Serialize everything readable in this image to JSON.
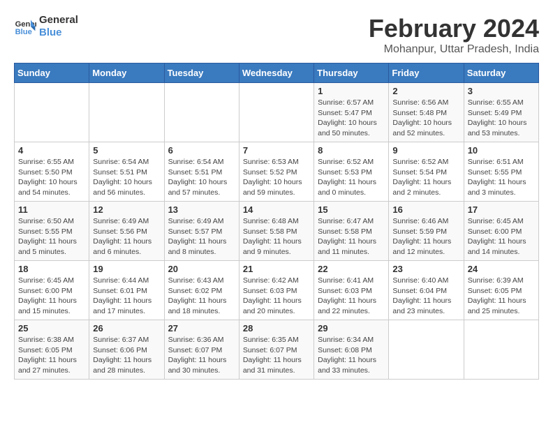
{
  "logo": {
    "line1": "General",
    "line2": "Blue"
  },
  "title": "February 2024",
  "subtitle": "Mohanpur, Uttar Pradesh, India",
  "days_of_week": [
    "Sunday",
    "Monday",
    "Tuesday",
    "Wednesday",
    "Thursday",
    "Friday",
    "Saturday"
  ],
  "weeks": [
    [
      {
        "day": "",
        "info": ""
      },
      {
        "day": "",
        "info": ""
      },
      {
        "day": "",
        "info": ""
      },
      {
        "day": "",
        "info": ""
      },
      {
        "day": "1",
        "info": "Sunrise: 6:57 AM\nSunset: 5:47 PM\nDaylight: 10 hours\nand 50 minutes."
      },
      {
        "day": "2",
        "info": "Sunrise: 6:56 AM\nSunset: 5:48 PM\nDaylight: 10 hours\nand 52 minutes."
      },
      {
        "day": "3",
        "info": "Sunrise: 6:55 AM\nSunset: 5:49 PM\nDaylight: 10 hours\nand 53 minutes."
      }
    ],
    [
      {
        "day": "4",
        "info": "Sunrise: 6:55 AM\nSunset: 5:50 PM\nDaylight: 10 hours\nand 54 minutes."
      },
      {
        "day": "5",
        "info": "Sunrise: 6:54 AM\nSunset: 5:51 PM\nDaylight: 10 hours\nand 56 minutes."
      },
      {
        "day": "6",
        "info": "Sunrise: 6:54 AM\nSunset: 5:51 PM\nDaylight: 10 hours\nand 57 minutes."
      },
      {
        "day": "7",
        "info": "Sunrise: 6:53 AM\nSunset: 5:52 PM\nDaylight: 10 hours\nand 59 minutes."
      },
      {
        "day": "8",
        "info": "Sunrise: 6:52 AM\nSunset: 5:53 PM\nDaylight: 11 hours\nand 0 minutes."
      },
      {
        "day": "9",
        "info": "Sunrise: 6:52 AM\nSunset: 5:54 PM\nDaylight: 11 hours\nand 2 minutes."
      },
      {
        "day": "10",
        "info": "Sunrise: 6:51 AM\nSunset: 5:55 PM\nDaylight: 11 hours\nand 3 minutes."
      }
    ],
    [
      {
        "day": "11",
        "info": "Sunrise: 6:50 AM\nSunset: 5:55 PM\nDaylight: 11 hours\nand 5 minutes."
      },
      {
        "day": "12",
        "info": "Sunrise: 6:49 AM\nSunset: 5:56 PM\nDaylight: 11 hours\nand 6 minutes."
      },
      {
        "day": "13",
        "info": "Sunrise: 6:49 AM\nSunset: 5:57 PM\nDaylight: 11 hours\nand 8 minutes."
      },
      {
        "day": "14",
        "info": "Sunrise: 6:48 AM\nSunset: 5:58 PM\nDaylight: 11 hours\nand 9 minutes."
      },
      {
        "day": "15",
        "info": "Sunrise: 6:47 AM\nSunset: 5:58 PM\nDaylight: 11 hours\nand 11 minutes."
      },
      {
        "day": "16",
        "info": "Sunrise: 6:46 AM\nSunset: 5:59 PM\nDaylight: 11 hours\nand 12 minutes."
      },
      {
        "day": "17",
        "info": "Sunrise: 6:45 AM\nSunset: 6:00 PM\nDaylight: 11 hours\nand 14 minutes."
      }
    ],
    [
      {
        "day": "18",
        "info": "Sunrise: 6:45 AM\nSunset: 6:00 PM\nDaylight: 11 hours\nand 15 minutes."
      },
      {
        "day": "19",
        "info": "Sunrise: 6:44 AM\nSunset: 6:01 PM\nDaylight: 11 hours\nand 17 minutes."
      },
      {
        "day": "20",
        "info": "Sunrise: 6:43 AM\nSunset: 6:02 PM\nDaylight: 11 hours\nand 18 minutes."
      },
      {
        "day": "21",
        "info": "Sunrise: 6:42 AM\nSunset: 6:03 PM\nDaylight: 11 hours\nand 20 minutes."
      },
      {
        "day": "22",
        "info": "Sunrise: 6:41 AM\nSunset: 6:03 PM\nDaylight: 11 hours\nand 22 minutes."
      },
      {
        "day": "23",
        "info": "Sunrise: 6:40 AM\nSunset: 6:04 PM\nDaylight: 11 hours\nand 23 minutes."
      },
      {
        "day": "24",
        "info": "Sunrise: 6:39 AM\nSunset: 6:05 PM\nDaylight: 11 hours\nand 25 minutes."
      }
    ],
    [
      {
        "day": "25",
        "info": "Sunrise: 6:38 AM\nSunset: 6:05 PM\nDaylight: 11 hours\nand 27 minutes."
      },
      {
        "day": "26",
        "info": "Sunrise: 6:37 AM\nSunset: 6:06 PM\nDaylight: 11 hours\nand 28 minutes."
      },
      {
        "day": "27",
        "info": "Sunrise: 6:36 AM\nSunset: 6:07 PM\nDaylight: 11 hours\nand 30 minutes."
      },
      {
        "day": "28",
        "info": "Sunrise: 6:35 AM\nSunset: 6:07 PM\nDaylight: 11 hours\nand 31 minutes."
      },
      {
        "day": "29",
        "info": "Sunrise: 6:34 AM\nSunset: 6:08 PM\nDaylight: 11 hours\nand 33 minutes."
      },
      {
        "day": "",
        "info": ""
      },
      {
        "day": "",
        "info": ""
      }
    ]
  ]
}
